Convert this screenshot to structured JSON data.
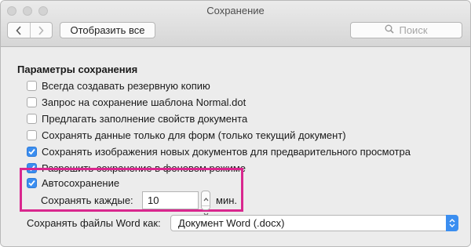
{
  "window": {
    "title": "Сохранение"
  },
  "toolbar": {
    "show_all_label": "Отобразить все",
    "search_placeholder": "Поиск",
    "back_icon": "chevron-left-icon",
    "forward_icon": "chevron-right-icon",
    "search_icon": "magnifier-icon"
  },
  "save_options": {
    "section_title": "Параметры сохранения",
    "options": [
      {
        "label": "Всегда создавать резервную копию",
        "checked": false
      },
      {
        "label": "Запрос на сохранение шаблона Normal.dot",
        "checked": false
      },
      {
        "label": "Предлагать заполнение свойств документа",
        "checked": false
      },
      {
        "label": "Сохранять данные только для форм (только текущий документ)",
        "checked": false
      },
      {
        "label": "Сохранять изображения новых документов для предварительного просмотра",
        "checked": true
      },
      {
        "label": "Разрешить сохранение в фоновом режиме",
        "checked": true
      },
      {
        "label": "Автосохранение",
        "checked": true
      }
    ],
    "autosave_interval": {
      "label": "Сохранять каждые:",
      "value": "10",
      "unit": "мин."
    },
    "file_format": {
      "label": "Сохранять файлы Word как:",
      "value": "Документ Word (.docx)"
    }
  },
  "colors": {
    "highlight": "#d9278e",
    "accent": "#3b8ef0"
  }
}
